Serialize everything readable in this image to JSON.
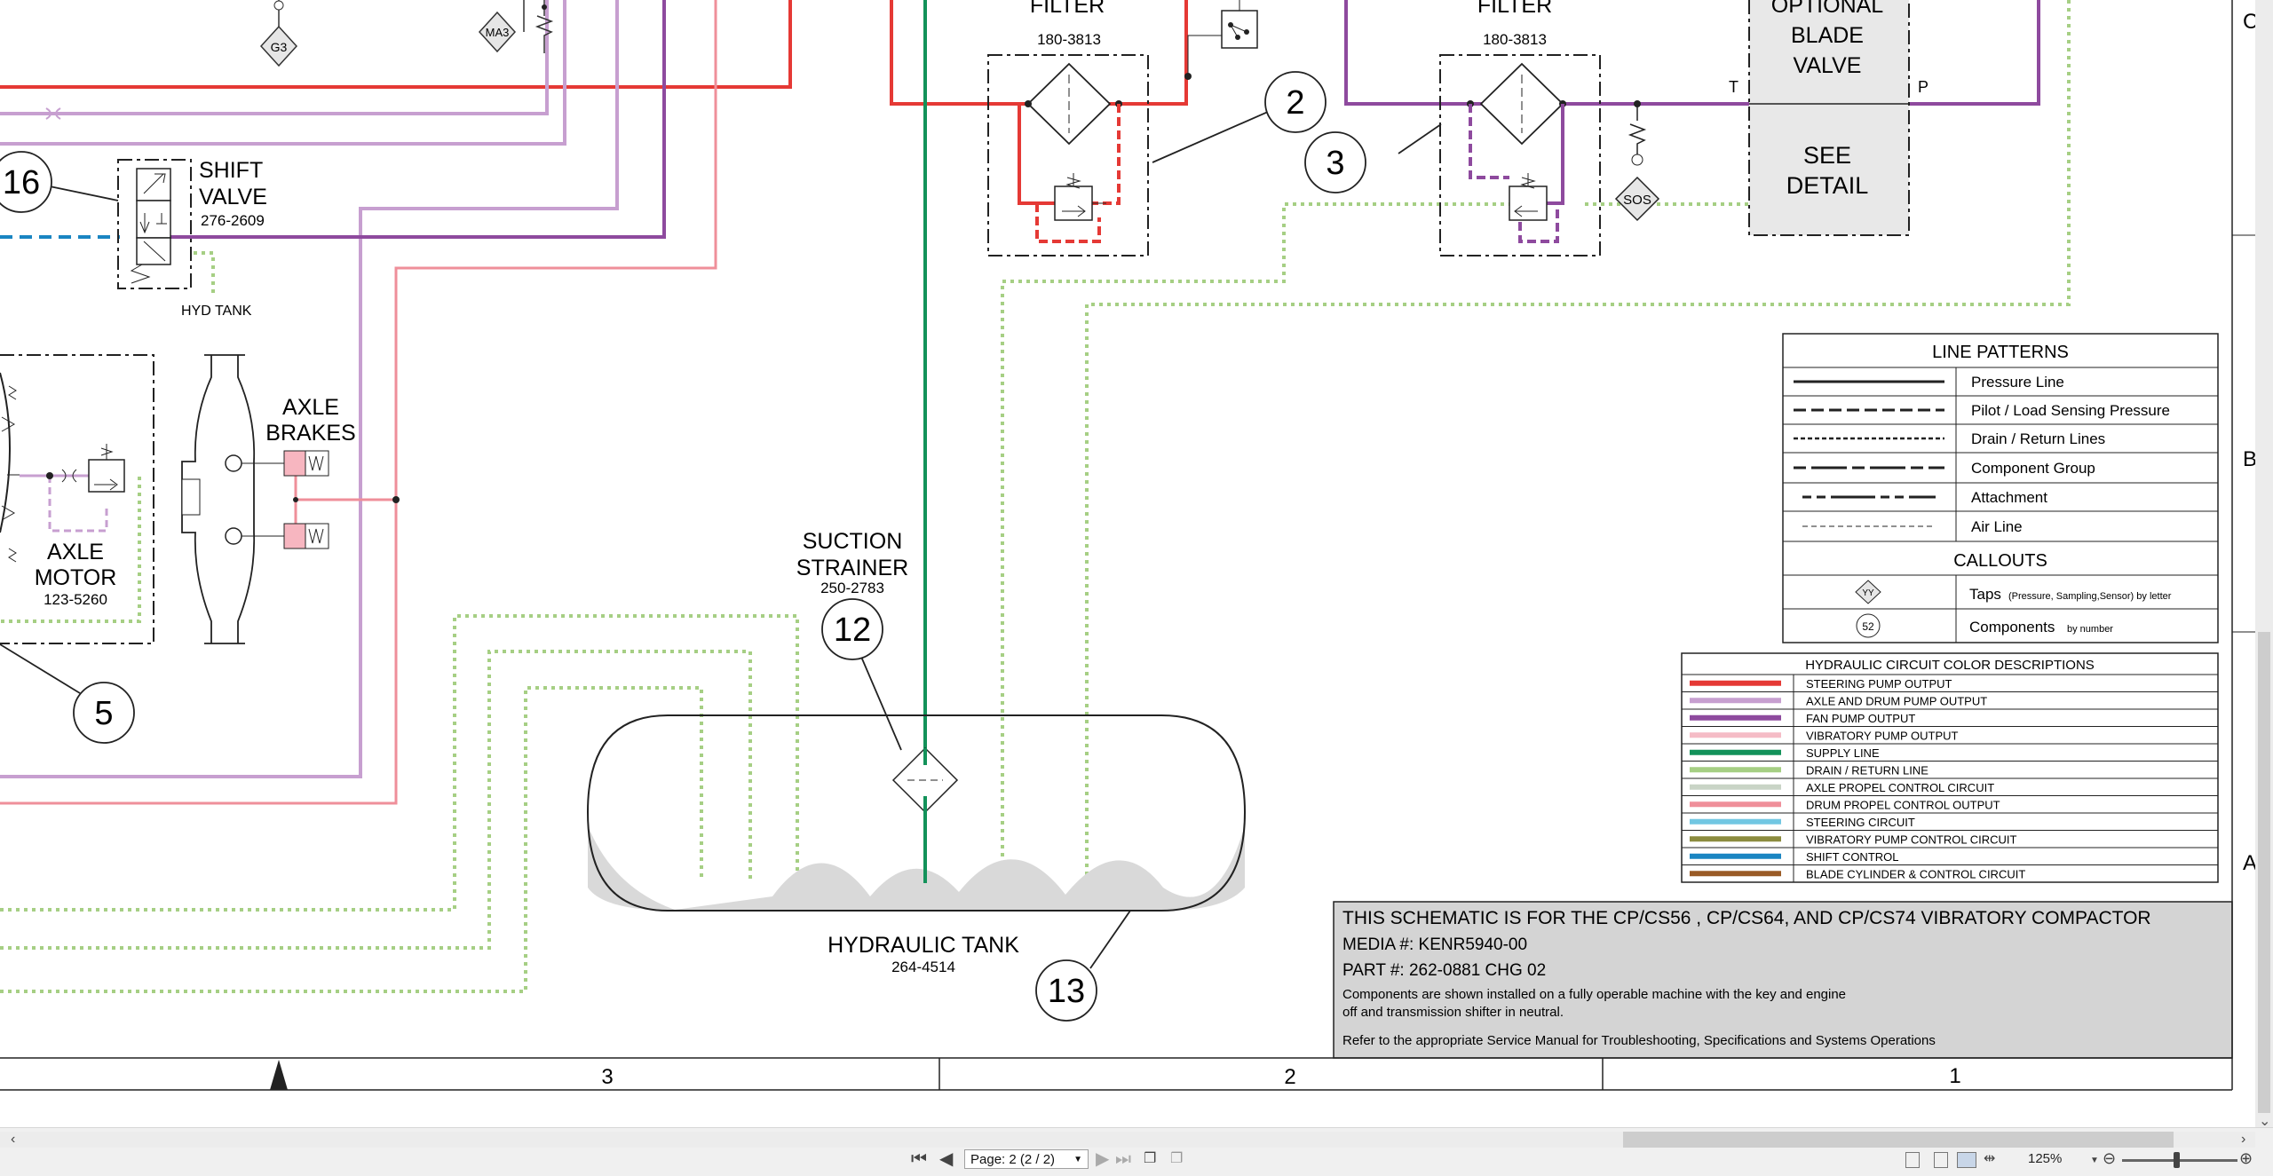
{
  "components": {
    "filter_left": {
      "title": "FILTER",
      "part": "180-3813"
    },
    "filter_right": {
      "title": "FILTER",
      "part": "180-3813"
    },
    "optional_valve": {
      "line1": "OPTIONAL",
      "line2": "BLADE",
      "line3": "VALVE",
      "port_t": "T",
      "port_p": "P"
    },
    "see_detail": {
      "line1": "SEE",
      "line2": "DETAIL"
    },
    "shift_valve": {
      "line1": "SHIFT",
      "line2": "VALVE",
      "part": "276-2609",
      "tank": "HYD TANK"
    },
    "axle_brakes": {
      "line1": "AXLE",
      "line2": "BRAKES"
    },
    "axle_motor": {
      "line1": "AXLE",
      "line2": "MOTOR",
      "part": "123-5260"
    },
    "suction_strainer": {
      "line1": "SUCTION",
      "line2": "STRAINER",
      "part": "250-2783"
    },
    "hydraulic_tank": {
      "name": "HYDRAULIC TANK",
      "part": "264-4514"
    }
  },
  "callouts": {
    "c2": "2",
    "c3": "3",
    "c5": "5",
    "c12": "12",
    "c13": "13",
    "c16": "16"
  },
  "taps": {
    "g3": "G3",
    "ma3": "MA3",
    "sos": "SOS"
  },
  "line_patterns": {
    "title": "LINE PATTERNS",
    "rows": [
      "Pressure Line",
      "Pilot / Load Sensing Pressure",
      "Drain / Return Lines",
      "Component Group",
      "Attachment",
      "Air Line"
    ],
    "callouts_title": "CALLOUTS",
    "taps_label": "Taps",
    "taps_note": "(Pressure, Sampling,Sensor) by letter",
    "taps_symbol": "YY",
    "components_label": "Components",
    "components_note": "by number",
    "components_symbol": "52"
  },
  "color_descriptions": {
    "title": "HYDRAULIC CIRCUIT COLOR DESCRIPTIONS",
    "rows": [
      {
        "color": "#e53935",
        "label": "STEERING PUMP OUTPUT"
      },
      {
        "color": "#c79fd0",
        "label": "AXLE AND DRUM PUMP OUTPUT"
      },
      {
        "color": "#8e4a9e",
        "label": "FAN PUMP OUTPUT"
      },
      {
        "color": "#f5bcc6",
        "label": "VIBRATORY PUMP OUTPUT"
      },
      {
        "color": "#13925a",
        "label": "SUPPLY LINE"
      },
      {
        "color": "#a6cf84",
        "label": "DRAIN / RETURN LINE"
      },
      {
        "color": "#c9d4c6",
        "label": "AXLE PROPEL CONTROL CIRCUIT"
      },
      {
        "color": "#ef8f9a",
        "label": "DRUM PROPEL CONTROL OUTPUT"
      },
      {
        "color": "#72c7e2",
        "label": "STEERING CIRCUIT"
      },
      {
        "color": "#8c8c3f",
        "label": "VIBRATORY PUMP CONTROL CIRCUIT"
      },
      {
        "color": "#1a85c2",
        "label": "SHIFT CONTROL"
      },
      {
        "color": "#9a5b26",
        "label": "BLADE CYLINDER & CONTROL CIRCUIT"
      }
    ]
  },
  "title_block": {
    "heading": "THIS SCHEMATIC IS FOR THE CP/CS56 , CP/CS64, AND CP/CS74 VIBRATORY COMPACTOR",
    "media": "MEDIA #: KENR5940-00",
    "part": "PART #: 262-0881 CHG 02",
    "note1": "Components are shown installed on a fully operable machine with the key and engine",
    "note2": "off and transmission shifter in neutral.",
    "note3": "Refer to the appropriate Service Manual for Troubleshooting, Specifications and Systems Operations"
  },
  "grid": {
    "zones": [
      "3",
      "2",
      "1"
    ],
    "side_letters": [
      "C",
      "B",
      "A"
    ]
  },
  "statusbar": {
    "page": "Page: 2 (2 / 2)",
    "zoom": "125%"
  },
  "colors": {
    "steering": "#e53935",
    "axle_drum": "#c79fd0",
    "fan": "#8e4a9e",
    "vib_output": "#f5bcc6",
    "supply": "#13925a",
    "drain": "#a6cf84",
    "drum_propel": "#ef8f9a",
    "shift": "#1a85c2",
    "tank_fill": "#d9d9d9"
  }
}
